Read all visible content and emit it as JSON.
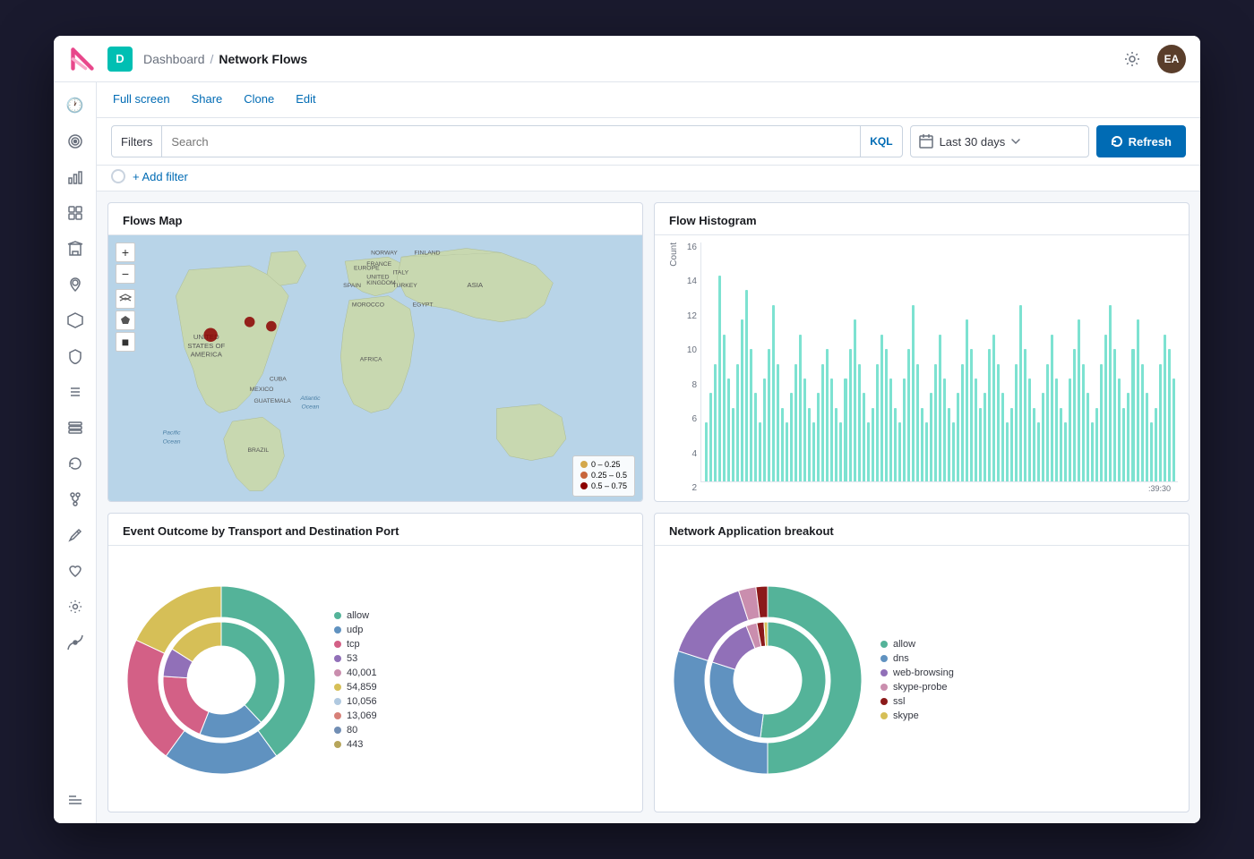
{
  "app": {
    "logo_letter": "K",
    "app_icon_letter": "D",
    "breadcrumb_parent": "Dashboard",
    "breadcrumb_separator": "/",
    "breadcrumb_current": "Network Flows",
    "settings_icon": "⚙",
    "avatar_initials": "EA"
  },
  "sub_nav": {
    "links": [
      "Full screen",
      "Share",
      "Clone",
      "Edit"
    ]
  },
  "filter_bar": {
    "filters_label": "Filters",
    "search_placeholder": "Search",
    "kql_label": "KQL",
    "time_value": "Last 30 days",
    "refresh_label": "Refresh"
  },
  "add_filter": {
    "label": "+ Add filter"
  },
  "sidebar": {
    "icons": [
      {
        "name": "clock-icon",
        "symbol": "🕐"
      },
      {
        "name": "target-icon",
        "symbol": "◎"
      },
      {
        "name": "bar-chart-icon",
        "symbol": "📊"
      },
      {
        "name": "grid-icon",
        "symbol": "▦"
      },
      {
        "name": "building-icon",
        "symbol": "🏛"
      },
      {
        "name": "location-icon",
        "symbol": "📍"
      },
      {
        "name": "puzzle-icon",
        "symbol": "⬡"
      },
      {
        "name": "shield-icon",
        "symbol": "🛡"
      },
      {
        "name": "list-icon",
        "symbol": "📋"
      },
      {
        "name": "stack-icon",
        "symbol": "🗂"
      },
      {
        "name": "refresh-icon",
        "symbol": "↺"
      },
      {
        "name": "fork-icon",
        "symbol": "⑂"
      },
      {
        "name": "tool-icon",
        "symbol": "🔧"
      },
      {
        "name": "heart-icon",
        "symbol": "❤"
      },
      {
        "name": "gear-icon",
        "symbol": "⚙"
      },
      {
        "name": "signal-icon",
        "symbol": "📡"
      }
    ],
    "bottom_icon": {
      "name": "menu-icon",
      "symbol": "☰"
    }
  },
  "panels": {
    "flows_map": {
      "title": "Flows Map",
      "map_controls": [
        "+",
        "−",
        "⊞",
        "⬟",
        "■"
      ]
    },
    "flow_histogram": {
      "title": "Flow Histogram",
      "y_axis_label": "Count",
      "y_labels": [
        "16",
        "14",
        "12",
        "10",
        "8",
        "6",
        "4",
        "2"
      ],
      "time_label": ":39:30",
      "bars": [
        4,
        6,
        8,
        14,
        10,
        7,
        5,
        8,
        11,
        13,
        9,
        6,
        4,
        7,
        9,
        12,
        8,
        5,
        4,
        6,
        8,
        10,
        7,
        5,
        4,
        6,
        8,
        9,
        7,
        5,
        4,
        7,
        9,
        11,
        8,
        6,
        4,
        5,
        8,
        10,
        9,
        7,
        5,
        4,
        7,
        9,
        12,
        8,
        5,
        4,
        6,
        8,
        10,
        7,
        5,
        4,
        6,
        8,
        11,
        9,
        7,
        5,
        6,
        9,
        10,
        8,
        6,
        4,
        5,
        8,
        12,
        9,
        7,
        5,
        4,
        6,
        8,
        10,
        7,
        5,
        4,
        7,
        9,
        11,
        8,
        6,
        4,
        5,
        8,
        10,
        12,
        9,
        7,
        5,
        6,
        9,
        11,
        8,
        6,
        4,
        5,
        8,
        10,
        9,
        7
      ]
    },
    "event_outcome": {
      "title": "Event Outcome by Transport and Destination Port",
      "legend": [
        {
          "label": "allow",
          "color": "#54b399"
        },
        {
          "label": "udp",
          "color": "#6092c0"
        },
        {
          "label": "tcp",
          "color": "#d36086"
        },
        {
          "label": "53",
          "color": "#9170b8"
        },
        {
          "label": "40,001",
          "color": "#ca8eae"
        },
        {
          "label": "54,859",
          "color": "#d6bf57"
        },
        {
          "label": "10,056",
          "color": "#b0c9e0"
        },
        {
          "label": "13,069",
          "color": "#d78078"
        },
        {
          "label": "80",
          "color": "#718eb4"
        },
        {
          "label": "443",
          "color": "#b6a55b"
        }
      ],
      "outer_segments": [
        {
          "color": "#54b399",
          "pct": 40
        },
        {
          "color": "#6092c0",
          "pct": 20
        },
        {
          "color": "#d36086",
          "pct": 22
        },
        {
          "color": "#d6bf57",
          "pct": 18
        }
      ],
      "inner_segments": [
        {
          "color": "#54b399",
          "pct": 38
        },
        {
          "color": "#6092c0",
          "pct": 18
        },
        {
          "color": "#d36086",
          "pct": 20
        },
        {
          "color": "#9170b8",
          "pct": 8
        },
        {
          "color": "#d6bf57",
          "pct": 16
        }
      ]
    },
    "network_app": {
      "title": "Network Application breakout",
      "legend": [
        {
          "label": "allow",
          "color": "#54b399"
        },
        {
          "label": "dns",
          "color": "#6092c0"
        },
        {
          "label": "web-browsing",
          "color": "#9170b8"
        },
        {
          "label": "skype-probe",
          "color": "#ca8eae"
        },
        {
          "label": "ssl",
          "color": "#8b1a1a"
        },
        {
          "label": "skype",
          "color": "#d6bf57"
        }
      ],
      "outer_segments": [
        {
          "color": "#54b399",
          "pct": 50
        },
        {
          "color": "#6092c0",
          "pct": 30
        },
        {
          "color": "#9170b8",
          "pct": 15
        },
        {
          "color": "#ca8eae",
          "pct": 3
        },
        {
          "color": "#8b1a1a",
          "pct": 2
        }
      ],
      "inner_segments": [
        {
          "color": "#54b399",
          "pct": 52
        },
        {
          "color": "#6092c0",
          "pct": 28
        },
        {
          "color": "#9170b8",
          "pct": 14
        },
        {
          "color": "#ca8eae",
          "pct": 3
        },
        {
          "color": "#8b1a1a",
          "pct": 2
        },
        {
          "color": "#d6bf57",
          "pct": 1
        }
      ]
    }
  }
}
